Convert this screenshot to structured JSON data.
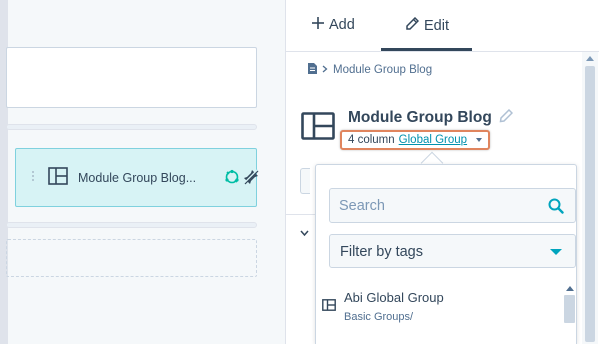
{
  "tabs": {
    "add_label": "Add",
    "edit_label": "Edit",
    "active": "edit"
  },
  "breadcrumb": {
    "current": "Module Group Blog"
  },
  "canvas": {
    "selected_module_label": "Module Group Blog..."
  },
  "module": {
    "title": "Module Group Blog",
    "column_text": "4 column",
    "group_link": "Global Group"
  },
  "dropdown": {
    "search_placeholder": "Search",
    "filter_label": "Filter by tags",
    "items": [
      {
        "title": "Abi Global Group",
        "subtitle": "Basic Groups/"
      }
    ]
  },
  "colors": {
    "accent": "#00a4bd",
    "link": "#0091ae",
    "highlight": "#e0855e",
    "text": "#33475b"
  }
}
